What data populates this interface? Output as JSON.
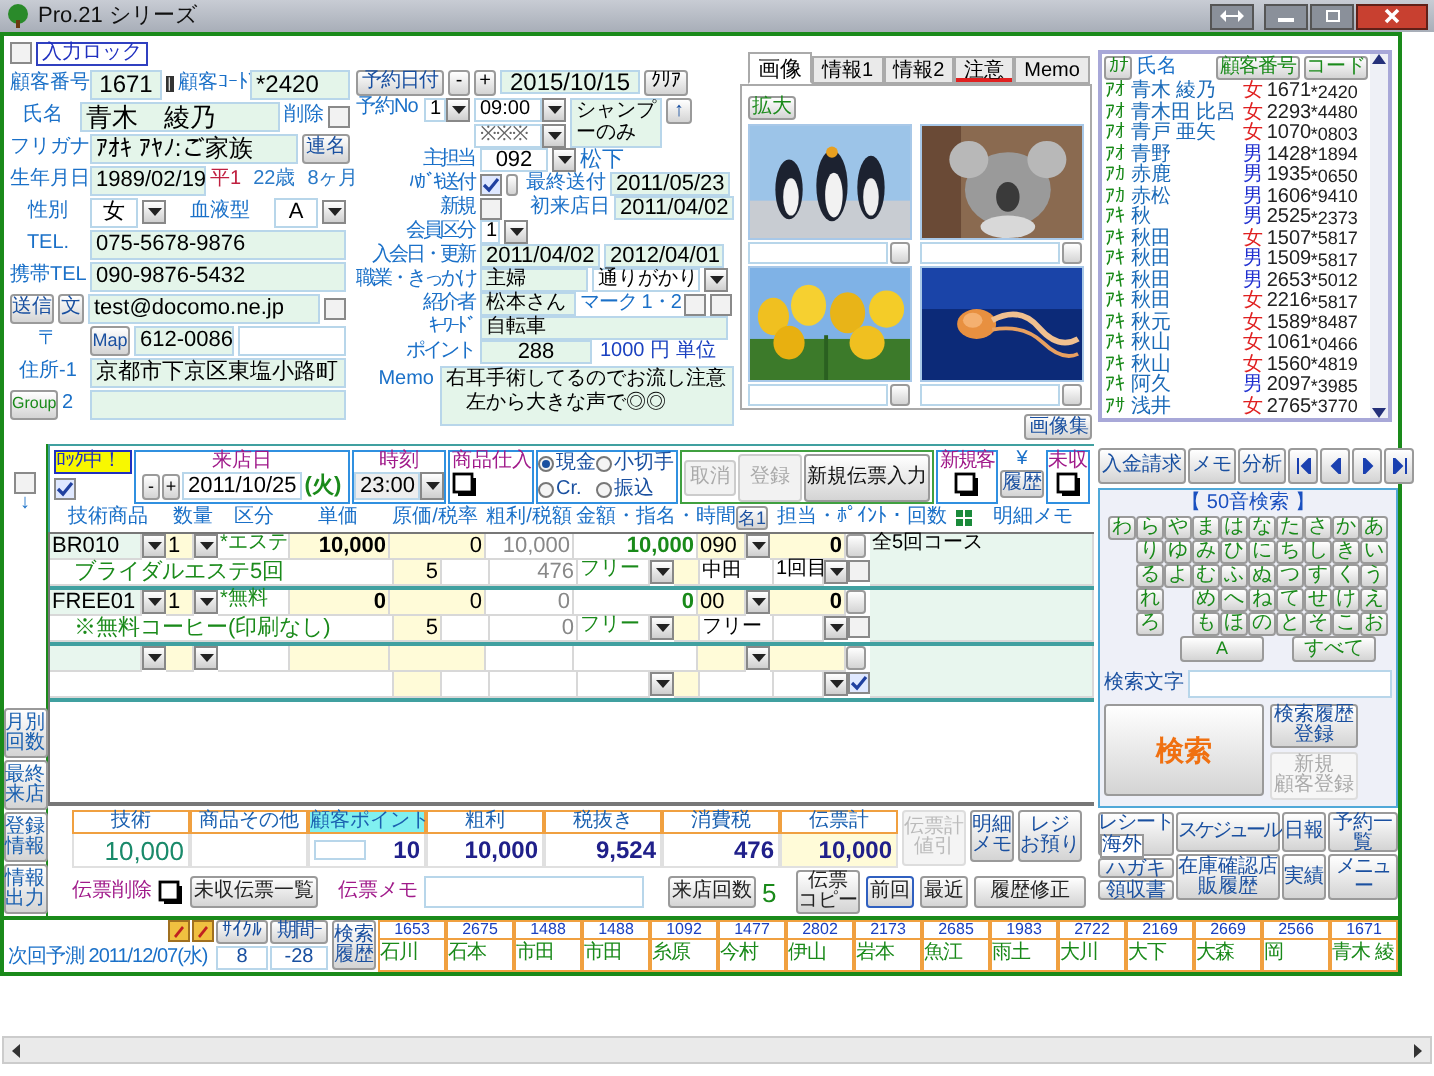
{
  "window": {
    "title": "Pro.21 シリーズ"
  },
  "input_lock": {
    "label": "入力ロック",
    "checked": false
  },
  "customer": {
    "number_label": "顧客番号",
    "number": "1671",
    "code_label": "顧客ｺｰﾄﾞ",
    "code": "*2420",
    "name_label": "氏名",
    "name": "青木　綾乃",
    "delete_label": "削除",
    "delete_checked": false,
    "kana_label": "フリガナ",
    "kana": "ｱｵｷ ｱﾔﾉ:ご家族",
    "kana_button": "連名",
    "birth_label": "生年月日",
    "birth": "1989/02/19",
    "era": "平1",
    "age": "22",
    "age_unit": "歳",
    "months": "8",
    "months_unit": "ヶ月",
    "sex_label": "性別",
    "sex": "女",
    "blood_label": "血液型",
    "blood": "A",
    "tel_label": "TEL.",
    "tel": "075-5678-9876",
    "mobile_label": "携帯TEL",
    "mobile": "090-9876-5432",
    "send_button": "送信",
    "text_button": "文",
    "email": "test@docomo.ne.jp",
    "email_checked": false,
    "zip_label": "〒",
    "map_button": "Map",
    "zip": "612-0086",
    "address1_label": "住所-1",
    "address1": "京都市下京区東塩小路町",
    "group_button": "Group",
    "address2_label": "2"
  },
  "reservation": {
    "date_button": "予約日付",
    "minus": "-",
    "plus": "+",
    "date": "2015/10/15",
    "clear_button": "ｸﾘｱ",
    "no_label": "予約No",
    "no": "1",
    "time": "09:00",
    "time_2": "※※※",
    "menu": "シャンプーのみ",
    "up_button": "↑"
  },
  "details": {
    "staff_label": "主担当",
    "staff_code": "092",
    "staff_name": "松下",
    "postcard_label": "ﾊｶﾞｷ送付",
    "postcard_checked": true,
    "last_sent_label": "最終送付",
    "last_sent": "2011/05/23",
    "new_label": "新規",
    "new_checked": false,
    "first_visit_label": "初来店日",
    "first_visit": "2011/04/02",
    "member_label": "会員区分",
    "member": "1",
    "join_label": "入会日・更新",
    "join_date": "2011/04/02",
    "renew_date": "2012/04/01",
    "occupation_label": "職業・きっかけ",
    "occupation": "主婦",
    "trigger": "通りがかり",
    "referrer_label": "紹介者",
    "referrer": "松本さん",
    "mark_label": "マーク 1・2",
    "marks": [
      {
        "checked": false
      },
      {
        "checked": false
      }
    ],
    "keyword_label": "ｷｰﾜｰﾄﾞ",
    "keyword": "自転車",
    "points_label": "ポイント",
    "points": "288",
    "points_unit_value": "1000",
    "points_unit": "円 単位",
    "memo_label": "Memo",
    "memo_lines": [
      "右耳手術してるのでお流し注意",
      "　左から大きな声で◎◎"
    ]
  },
  "image_panel": {
    "tabs": [
      {
        "label": "画像",
        "selected": true,
        "flagged": false
      },
      {
        "label": "情報1",
        "selected": false,
        "flagged": false
      },
      {
        "label": "情報2",
        "selected": false,
        "flagged": false
      },
      {
        "label": "注意",
        "selected": false,
        "flagged": true
      },
      {
        "label": "Memo",
        "selected": false,
        "flagged": false
      }
    ],
    "zoom_button": "拡大",
    "album_button": "画像集"
  },
  "customer_list": {
    "kana_button": "ｶﾅ",
    "name_header": "氏名",
    "number_button": "顧客番号",
    "code_button": "コード",
    "rows": [
      {
        "kana": "ｱｵ",
        "name": "青木 綾乃",
        "sex": "女",
        "color": "#e02020",
        "number": "1671",
        "code": "*2420"
      },
      {
        "kana": "ｱｵ",
        "name": "青木田 比呂",
        "sex": "女",
        "color": "#e02020",
        "number": "2293",
        "code": "*4480"
      },
      {
        "kana": "ｱｵ",
        "name": "青戸 亜矢",
        "sex": "女",
        "color": "#e02020",
        "number": "1070",
        "code": "*0803"
      },
      {
        "kana": "ｱｵ",
        "name": "青野",
        "sex": "男",
        "color": "#2030d0",
        "number": "1428",
        "code": "*1894"
      },
      {
        "kana": "ｱｶ",
        "name": "赤鹿",
        "sex": "男",
        "color": "#2030d0",
        "number": "1935",
        "code": "*0650"
      },
      {
        "kana": "ｱｶ",
        "name": "赤松",
        "sex": "男",
        "color": "#2030d0",
        "number": "1606",
        "code": "*9410"
      },
      {
        "kana": "ｱｷ",
        "name": "秋",
        "sex": "男",
        "color": "#2030d0",
        "number": "2525",
        "code": "*2373"
      },
      {
        "kana": "ｱｷ",
        "name": "秋田",
        "sex": "女",
        "color": "#e02020",
        "number": "1507",
        "code": "*5817"
      },
      {
        "kana": "ｱｷ",
        "name": "秋田",
        "sex": "男",
        "color": "#2030d0",
        "number": "1509",
        "code": "*5817"
      },
      {
        "kana": "ｱｷ",
        "name": "秋田",
        "sex": "男",
        "color": "#2030d0",
        "number": "2653",
        "code": "*5012"
      },
      {
        "kana": "ｱｷ",
        "name": "秋田",
        "sex": "女",
        "color": "#e02020",
        "number": "2216",
        "code": "*5817"
      },
      {
        "kana": "ｱｷ",
        "name": "秋元",
        "sex": "女",
        "color": "#e02020",
        "number": "1589",
        "code": "*8487"
      },
      {
        "kana": "ｱｷ",
        "name": "秋山",
        "sex": "女",
        "color": "#e02020",
        "number": "1061",
        "code": "*0466"
      },
      {
        "kana": "ｱｷ",
        "name": "秋山",
        "sex": "女",
        "color": "#e02020",
        "number": "1560",
        "code": "*4819"
      },
      {
        "kana": "ｱｷ",
        "name": "阿久",
        "sex": "男",
        "color": "#2030d0",
        "number": "2097",
        "code": "*3985"
      },
      {
        "kana": "ｱｻ",
        "name": "浅井",
        "sex": "女",
        "color": "#e02020",
        "number": "2765",
        "code": "*3770"
      }
    ]
  },
  "slip": {
    "row_checked": false,
    "down_arrow": "↓",
    "lock_label": "ﾛｯｸ中！",
    "lock_checked": true,
    "visit_label": "来店日",
    "minus": "-",
    "plus": "+",
    "visit_date": "2011/10/25",
    "weekday": "(火)",
    "time_label": "時刻",
    "time": "23:00",
    "stock_label": "商品仕入",
    "payments": [
      {
        "label": "現金",
        "selected": true
      },
      {
        "label": "小切手",
        "selected": false
      },
      {
        "label": "Cr.",
        "selected": false
      },
      {
        "label": "振込",
        "selected": false
      }
    ],
    "actions": [
      {
        "label": "取消",
        "disabled": true
      },
      {
        "label": "登録",
        "disabled": true
      },
      {
        "label": "新規伝票入力",
        "disabled": false
      }
    ],
    "new_customer_label": "新規客",
    "yen": "¥",
    "history_button": "履歴",
    "unpaid_label": "未収",
    "columns": [
      "技術商品",
      "数量",
      "区分",
      "単価",
      "原価/税率",
      "粗利/税額",
      "金額・指名・時間",
      "担当・ﾎﾟｲﾝﾄ・回数",
      "明細メモ"
    ],
    "ratio_button": "名1",
    "items": [
      {
        "code": "BR010",
        "qty": "1",
        "category": "*エステ",
        "price": "10,000",
        "cost": "0",
        "profit": "10,000",
        "amount": "10,000",
        "staff_code": "090",
        "points": "0",
        "memo": "全5回コース",
        "name": "ブライダルエステ5回",
        "tax_rate": "5",
        "tax": "476",
        "nomination": "フリー",
        "staff_name": "中田",
        "count": "1回目",
        "checked": false
      },
      {
        "code": "FREE01",
        "qty": "1",
        "category": "*無料",
        "price": "0",
        "cost": "0",
        "profit": "0",
        "amount": "0",
        "staff_code": "00",
        "points": "0",
        "name": "※無料コーヒー(印刷なし)",
        "tax_rate": "5",
        "tax": "0",
        "nomination": "フリー",
        "staff_name": "フリー",
        "checked": false
      },
      {
        "checked": true
      }
    ]
  },
  "totals": {
    "columns": [
      {
        "label": "技術",
        "value": "10,000",
        "kind": "tech"
      },
      {
        "label": "商品その他",
        "kind": "plain"
      },
      {
        "label": "顧客ポイント",
        "value": "10",
        "kind": "points"
      },
      {
        "label": "粗利",
        "value": "10,000",
        "kind": "plain"
      },
      {
        "label": "税抜き",
        "value": "9,524",
        "kind": "plain"
      },
      {
        "label": "消費税",
        "value": "476",
        "kind": "plain"
      },
      {
        "label": "伝票計",
        "value": "10,000",
        "kind": "total"
      }
    ],
    "discount_button": {
      "label": "伝票計値引",
      "disabled": true
    },
    "detail_memo_button": "明細メモ",
    "register_button": [
      "レジ",
      "お預り"
    ],
    "delete_label": "伝票削除",
    "unpaid_list_button": "未収伝票一覧",
    "memo_label": "伝票メモ",
    "visit_count_button": "来店回数",
    "visit_count": "5",
    "copy_button": [
      "伝票",
      "コピー"
    ],
    "previous_button": "前回",
    "recent_button": "最近",
    "edit_history_button": "履歴修正"
  },
  "side_tabs": [
    "月別回数",
    "最終来店",
    "登録情報",
    "情報出力"
  ],
  "search_panel": {
    "top_buttons": [
      "入金請求",
      "メモ",
      "分析"
    ],
    "title": "【 50音検索 】",
    "kana_columns": [
      [
        "わ"
      ],
      [
        "ら",
        "り",
        "る",
        "れ",
        "ろ"
      ],
      [
        "や",
        "ゆ",
        "よ"
      ],
      [
        "ま",
        "み",
        "む",
        "め",
        "も"
      ],
      [
        "は",
        "ひ",
        "ふ",
        "へ",
        "ほ"
      ],
      [
        "な",
        "に",
        "ぬ",
        "ね",
        "の"
      ],
      [
        "た",
        "ち",
        "つ",
        "て",
        "と"
      ],
      [
        "さ",
        "し",
        "す",
        "せ",
        "そ"
      ],
      [
        "か",
        "き",
        "く",
        "け",
        "こ"
      ],
      [
        "あ",
        "い",
        "う",
        "え",
        "お"
      ]
    ],
    "alpha_button": "A",
    "all_button": "すべて",
    "search_label": "検索文字",
    "search_button": "検索",
    "save_history_button": "検索履歴登録",
    "new_customer_button": {
      "lines": [
        "新規",
        "顧客登録"
      ],
      "disabled": true
    }
  },
  "function_buttons": {
    "receipt": "レシート",
    "overseas": "海外",
    "postcard": "ハガキ",
    "invoice": "領収書",
    "schedule": "スケジュール",
    "stock": "在庫確認店販履歴",
    "daily": "日報",
    "results": "実績",
    "reservations": "予約一覧",
    "menu": "メニュー"
  },
  "next_visit": {
    "label": "次回予測",
    "date": "2011/12/07(水)",
    "cycle_label": "ｻｲｸﾙ",
    "cycle": "8",
    "period_label": "期間ｰ",
    "period": "-28",
    "search_history_button": "検索履歴"
  },
  "history": [
    {
      "number": "1653",
      "name": "石川"
    },
    {
      "number": "2675",
      "name": "石本"
    },
    {
      "number": "1488",
      "name": "市田"
    },
    {
      "number": "1488",
      "name": "市田"
    },
    {
      "number": "1092",
      "name": "糸原"
    },
    {
      "number": "1477",
      "name": "今村"
    },
    {
      "number": "2802",
      "name": "伊山"
    },
    {
      "number": "2173",
      "name": "岩本"
    },
    {
      "number": "2685",
      "name": "魚江"
    },
    {
      "number": "1983",
      "name": "雨土"
    },
    {
      "number": "2722",
      "name": "大川"
    },
    {
      "number": "2169",
      "name": "大下"
    },
    {
      "number": "2669",
      "name": "大森"
    },
    {
      "number": "2566",
      "name": "岡"
    },
    {
      "number": "1671",
      "name": "青木 綾"
    }
  ]
}
